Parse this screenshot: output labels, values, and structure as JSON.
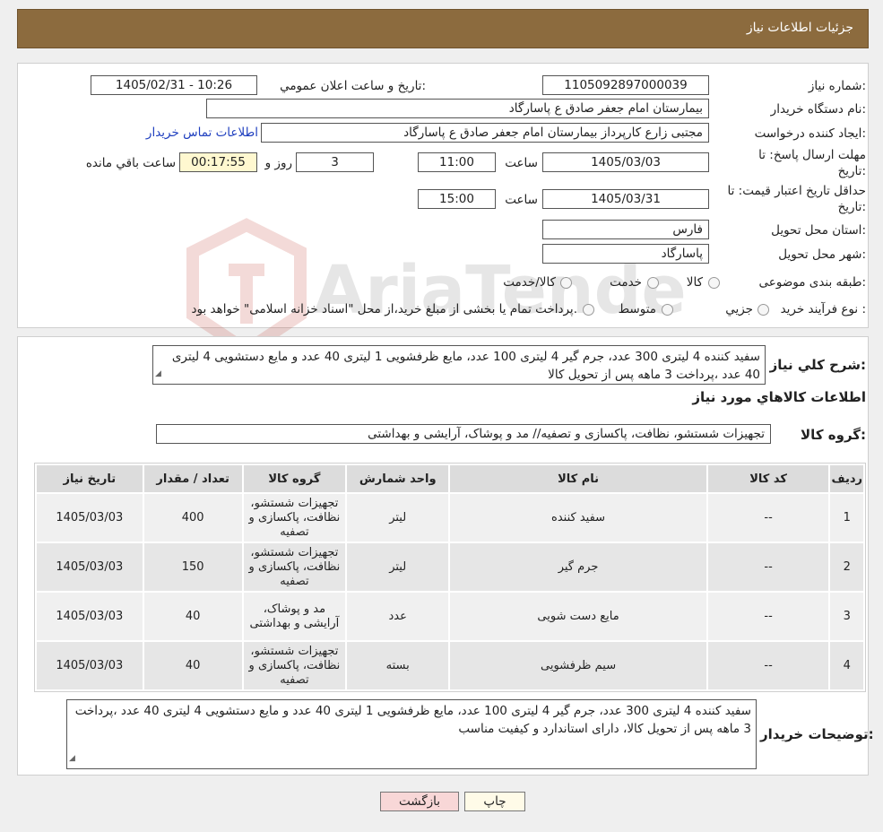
{
  "header": {
    "title": "جزئیات اطلاعات نیاز"
  },
  "form": {
    "need_number_label": "شماره نیاز:",
    "need_number": "1105092897000039",
    "announce_label": "تاریخ و ساعت اعلان عمومي:",
    "announce_value": "1405/02/31 - 10:26",
    "buyer_org_label": "نام دستگاه خریدار:",
    "buyer_org": "بیمارستان امام جعفر صادق ع  پاسارگاد",
    "creator_label": "ایجاد کننده درخواست:",
    "creator": "مجتبی زارع کارپرداز بیمارستان امام جعفر صادق ع  پاسارگاد",
    "contact_link": "اطلاعات تماس خریدار",
    "deadline_label_1": "مهلت ارسال پاسخ: تا",
    "deadline_label_2": "تاریخ:",
    "deadline_date": "1405/03/03",
    "time_label": "ساعت",
    "deadline_time": "11:00",
    "days_value": "3",
    "days_label": "روز و",
    "remaining_time": "00:17:55",
    "remaining_label": "ساعت باقي مانده",
    "validity_label_1": "حداقل تاریخ اعتبار قیمت: تا",
    "validity_label_2": "تاریخ:",
    "validity_date": "1405/03/31",
    "validity_time": "15:00",
    "province_label": "استان محل تحویل:",
    "province": "فارس",
    "city_label": "شهر محل تحویل:",
    "city": "پاسارگاد",
    "category_label": "طبقه بندی موضوعی:",
    "category_options": [
      "کالا",
      "خدمت",
      "کالا/خدمت"
    ],
    "process_label": "نوع فرآیند خرید :",
    "process_options": [
      "جزیي",
      "متوسط"
    ],
    "process_note": "پرداخت تمام یا بخشی از مبلغ خرید،از محل \"اسناد خزانه اسلامی\" خواهد بود."
  },
  "summary": {
    "label": "شرح کلي نیاز:",
    "text": "سفید کننده 4 لیتری 300 عدد، جرم گیر 4 لیتری 100 عدد، مایع ظرفشویی 1 لیتری 40 عدد و مایع دستشویی 4 لیتری 40 عدد ،پرداخت 3 ماهه پس از تحویل کالا",
    "items_heading": "اطلاعات کالاهاي مورد نیاز",
    "group_label": "گروه کالا:",
    "group_value": "تجهیزات شستشو، نظافت، پاکسازی و تصفیه// مد و پوشاک، آرایشی و بهداشتی"
  },
  "table": {
    "headers": [
      "ردیف",
      "کد کالا",
      "نام کالا",
      "واحد شمارش",
      "گروه کالا",
      "تعداد / مقدار",
      "تاریخ نیاز"
    ],
    "rows": [
      {
        "row": "1",
        "code": "--",
        "name": "سفید کننده",
        "unit": "لیتر",
        "group": "تجهیزات شستشو، نظافت، پاکسازی و تصفیه",
        "qty": "400",
        "date": "1405/03/03"
      },
      {
        "row": "2",
        "code": "--",
        "name": "جرم گیر",
        "unit": "لیتر",
        "group": "تجهیزات شستشو، نظافت، پاکسازی و تصفیه",
        "qty": "150",
        "date": "1405/03/03"
      },
      {
        "row": "3",
        "code": "--",
        "name": "مایع دست شویی",
        "unit": "عدد",
        "group": "مد و پوشاک، آرایشی و بهداشتی",
        "qty": "40",
        "date": "1405/03/03"
      },
      {
        "row": "4",
        "code": "--",
        "name": "سیم ظرفشویی",
        "unit": "بسته",
        "group": "تجهیزات شستشو، نظافت، پاکسازی و تصفیه",
        "qty": "40",
        "date": "1405/03/03"
      }
    ]
  },
  "buyer_notes": {
    "label": "توضیحات خریدار:",
    "text": "سفید کننده 4 لیتری 300 عدد، جرم گیر 4 لیتری 100 عدد، مایع ظرفشویی 1 لیتری 40 عدد و مایع دستشویی 4 لیتری 40 عدد ،پرداخت 3 ماهه پس از تحویل کالا، دارای استاندارد و کیفیت مناسب"
  },
  "buttons": {
    "print": "چاپ",
    "back": "بازگشت"
  },
  "watermark": {
    "text": "AriaTender.neT"
  },
  "colors": {
    "header_bg": "#8c6b3e",
    "link": "#1f3fbf",
    "back_button_bg": "#f8d7d7",
    "timer_bg": "#fff8d0"
  }
}
